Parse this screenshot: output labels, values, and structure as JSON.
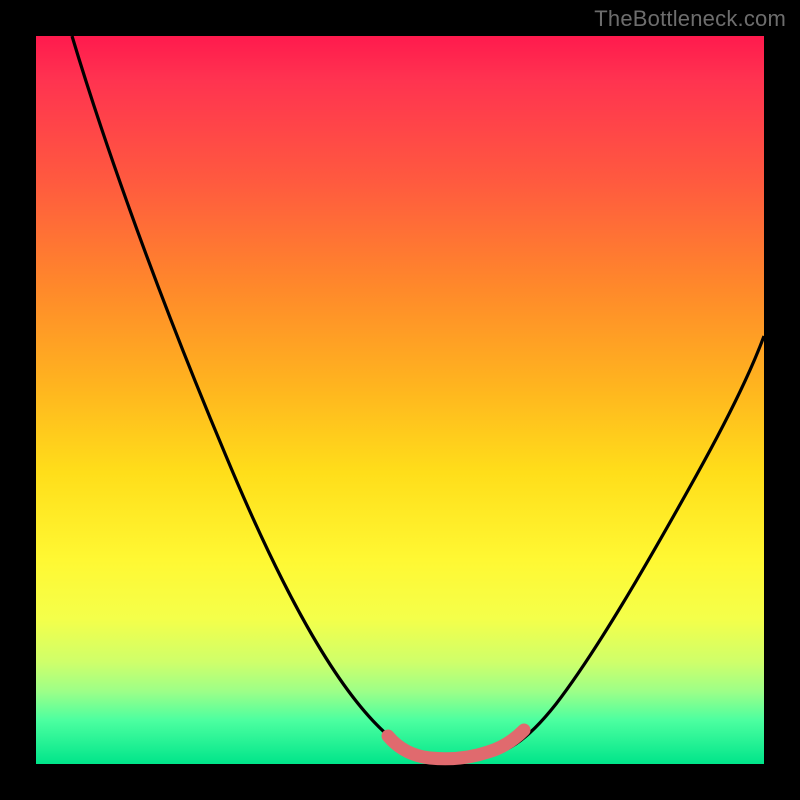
{
  "watermark": "TheBottleneck.com",
  "colors": {
    "frame": "#000000",
    "gradient_top": "#ff1a4d",
    "gradient_mid": "#ffde1a",
    "gradient_bottom": "#00e58a",
    "curve": "#000000",
    "highlight": "#e06a6e"
  },
  "chart_data": {
    "type": "line",
    "title": "",
    "xlabel": "",
    "ylabel": "",
    "xlim": [
      0,
      100
    ],
    "ylim": [
      0,
      100
    ],
    "series": [
      {
        "name": "main-curve",
        "x": [
          5,
          10,
          15,
          20,
          25,
          30,
          35,
          40,
          45,
          48,
          50,
          53,
          55,
          58,
          60,
          65,
          70,
          75,
          80,
          85,
          90,
          95,
          100
        ],
        "values": [
          100,
          91,
          82,
          73,
          63,
          53,
          43,
          33,
          22,
          14,
          8,
          3,
          1,
          0,
          0,
          0,
          2,
          6,
          13,
          22,
          32,
          43,
          55
        ]
      },
      {
        "name": "highlight-segment",
        "x": [
          50,
          53,
          55,
          58,
          60,
          63,
          65
        ],
        "values": [
          8,
          3,
          1,
          0,
          0,
          0.5,
          1.5
        ]
      }
    ]
  }
}
